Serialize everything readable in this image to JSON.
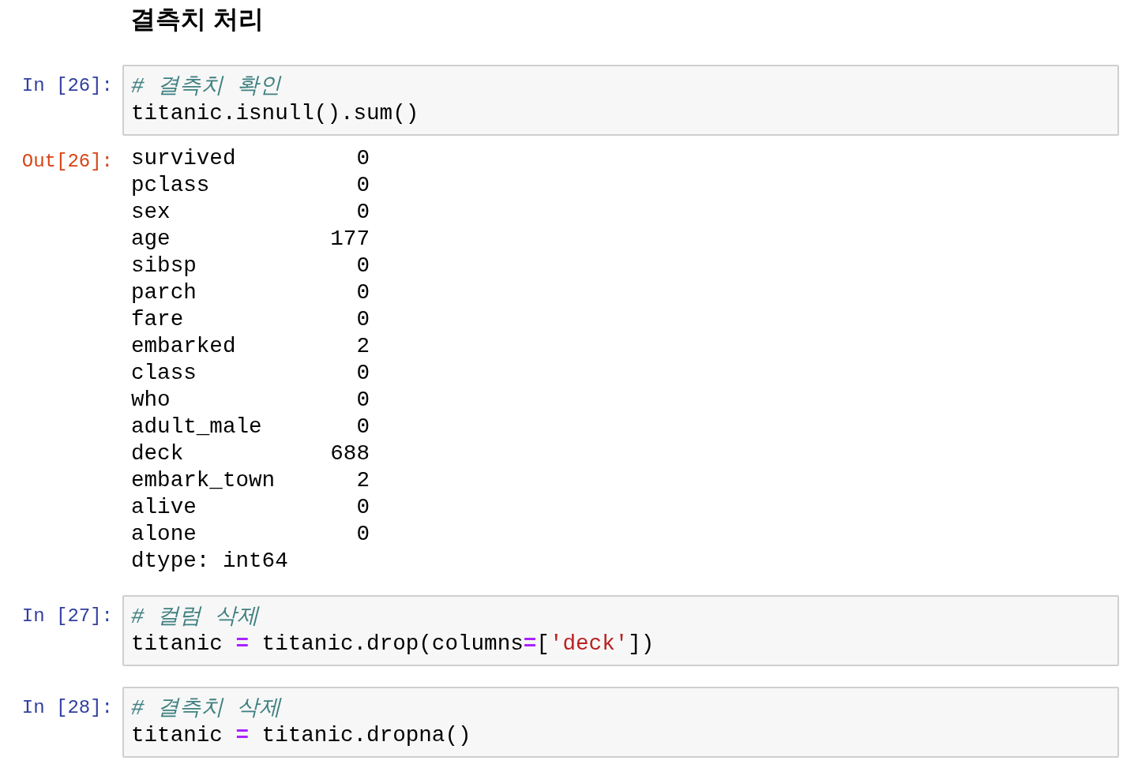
{
  "heading": "결측치 처리",
  "cells": [
    {
      "prompt": "In [26]:",
      "lines": [
        [
          {
            "kind": "comment",
            "text": "# 결측치 확인"
          }
        ],
        [
          {
            "kind": "plain",
            "text": "titanic.isnull().sum()"
          }
        ]
      ],
      "output": {
        "prompt": "Out[26]:",
        "rows": [
          {
            "name": "survived",
            "value": "0"
          },
          {
            "name": "pclass",
            "value": "0"
          },
          {
            "name": "sex",
            "value": "0"
          },
          {
            "name": "age",
            "value": "177"
          },
          {
            "name": "sibsp",
            "value": "0"
          },
          {
            "name": "parch",
            "value": "0"
          },
          {
            "name": "fare",
            "value": "0"
          },
          {
            "name": "embarked",
            "value": "2"
          },
          {
            "name": "class",
            "value": "0"
          },
          {
            "name": "who",
            "value": "0"
          },
          {
            "name": "adult_male",
            "value": "0"
          },
          {
            "name": "deck",
            "value": "688"
          },
          {
            "name": "embark_town",
            "value": "2"
          },
          {
            "name": "alive",
            "value": "0"
          },
          {
            "name": "alone",
            "value": "0"
          }
        ],
        "footer": "dtype: int64"
      }
    },
    {
      "prompt": "In [27]:",
      "lines": [
        [
          {
            "kind": "comment",
            "text": "# 컬럼 삭제"
          }
        ],
        [
          {
            "kind": "plain",
            "text": "titanic "
          },
          {
            "kind": "operator",
            "text": "="
          },
          {
            "kind": "plain",
            "text": " titanic.drop(columns"
          },
          {
            "kind": "operator",
            "text": "="
          },
          {
            "kind": "plain",
            "text": "["
          },
          {
            "kind": "string",
            "text": "'deck'"
          },
          {
            "kind": "plain",
            "text": "])"
          }
        ]
      ]
    },
    {
      "prompt": "In [28]:",
      "lines": [
        [
          {
            "kind": "comment",
            "text": "# 결측치 삭제"
          }
        ],
        [
          {
            "kind": "plain",
            "text": "titanic "
          },
          {
            "kind": "operator",
            "text": "="
          },
          {
            "kind": "plain",
            "text": " titanic.dropna()"
          }
        ]
      ]
    }
  ]
}
